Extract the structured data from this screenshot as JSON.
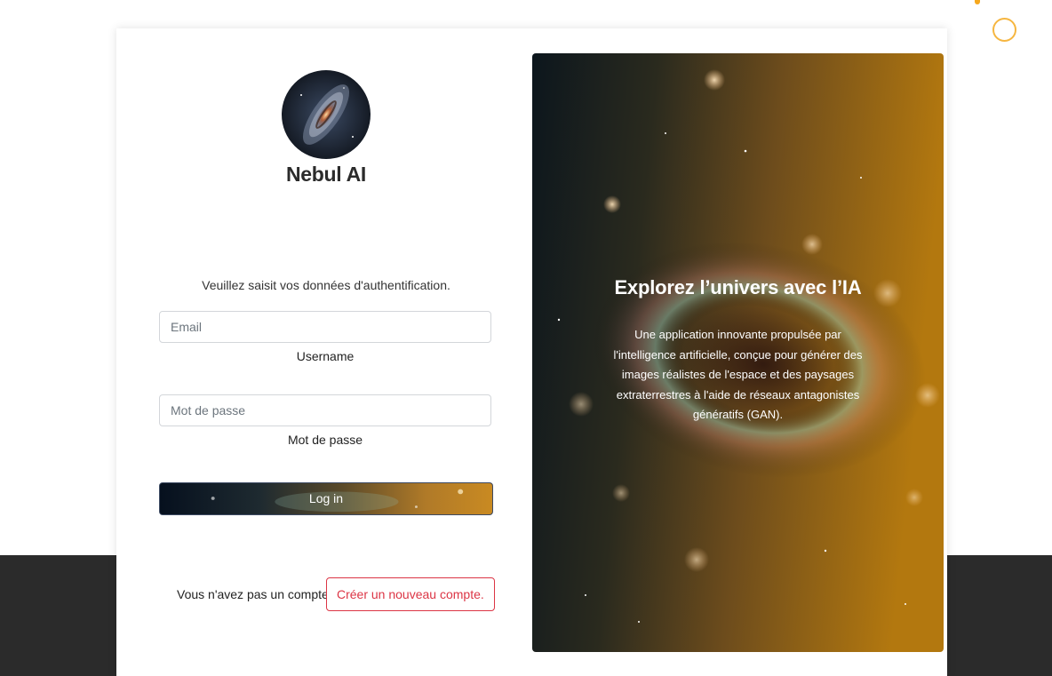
{
  "brand": {
    "name": "Nebul AI"
  },
  "login": {
    "instructions": "Veuillez saisit vos données d'authentification.",
    "email_placeholder": "Email",
    "email_label": "Username",
    "password_placeholder": "Mot de passe",
    "password_label": "Mot de passe",
    "submit_label": "Log in"
  },
  "signup": {
    "prompt": "Vous n'avez pas un compte?",
    "button_label": "Créer un nouveau compte."
  },
  "promo": {
    "title": "Explorez l’univers avec l’IA",
    "text": "Une application innovante propulsée par l'intelligence artificielle, conçue pour générer des images réalistes de l'espace et des paysages extraterrestres à l'aide de réseaux antagonistes génératifs (GAN)."
  },
  "colors": {
    "accent_danger": "#dc3545",
    "dark_band": "#2b2b2b",
    "decor_orange": "#f6a81d"
  }
}
